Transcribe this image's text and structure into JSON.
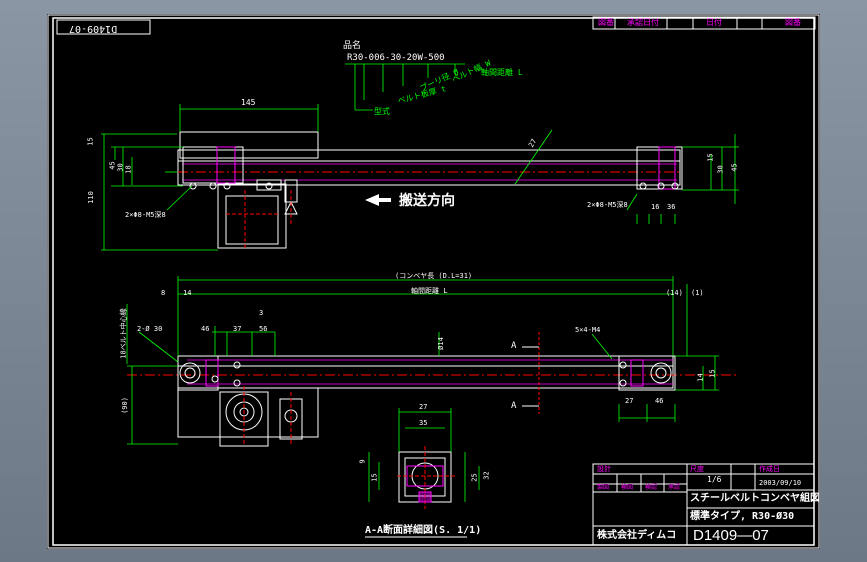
{
  "title_block_header": [
    "図番",
    "承認日付",
    "日付",
    "図番"
  ],
  "corner_number": "D1409-07",
  "part_number": {
    "heading": "品名",
    "code": "R30-006-30-20W-500",
    "legend": [
      "軸間距離 L",
      "ベルト幅 W",
      "プーリ径 Ø",
      "ベルト板厚 t",
      "型式"
    ]
  },
  "conveying_direction": "搬送方向",
  "dims_top": {
    "width_145": "145",
    "d15": "15",
    "d45": "45",
    "d30": "30",
    "d18": "18",
    "d110": "110",
    "d27": "27",
    "d15b": "15",
    "d30b": "30",
    "d45b": "45",
    "d16": "16",
    "d36": "36",
    "hole_left": "2×Φ8-M5深8",
    "hole_right": "2×Φ8-M5深8"
  },
  "dims_front": {
    "overall": "(コンベヤ長 (D.L=31)",
    "axis_distance": "軸間距離 L",
    "d8": "8",
    "d14": "14",
    "d14b": "(14)",
    "d1": "(1)",
    "d3": "3",
    "belt_center": "18ベルト中心線",
    "hole": "2-Ø 30",
    "d46": "46",
    "d37": "37",
    "d56": "56",
    "dia14": "Ø14",
    "tap": "5×4-M4",
    "section_a_top": "A",
    "section_a_bottom": "A",
    "d27": "27",
    "d46b": "46",
    "d14c": "14",
    "d15": "15",
    "d90": "(90)"
  },
  "section_view": {
    "d27": "27",
    "d35": "35",
    "d9": "9",
    "d15": "15",
    "d25": "25",
    "d32": "32",
    "label": "A-A断面詳細図(S. 1/1)"
  },
  "title_block": {
    "design": "設計",
    "scale_label": "尺度",
    "scale": "1/6",
    "date_label": "作成日",
    "date": "2003/09/10",
    "check_labels": [
      "製図",
      "検図",
      "検認",
      "承認"
    ],
    "title": "スチールベルトコンベヤ組図",
    "subtitle": "標準タイプ, R30-Ø30",
    "company": "株式会社ディムコ",
    "drawing_no": "D1409—07"
  },
  "colors": {
    "white": "#ffffff",
    "yellow": "#ffff00",
    "green": "#00ff00",
    "cyan": "#00ffff",
    "magenta": "#ff00ff",
    "red": "#ff0000",
    "gray": "#9a9a9a"
  }
}
